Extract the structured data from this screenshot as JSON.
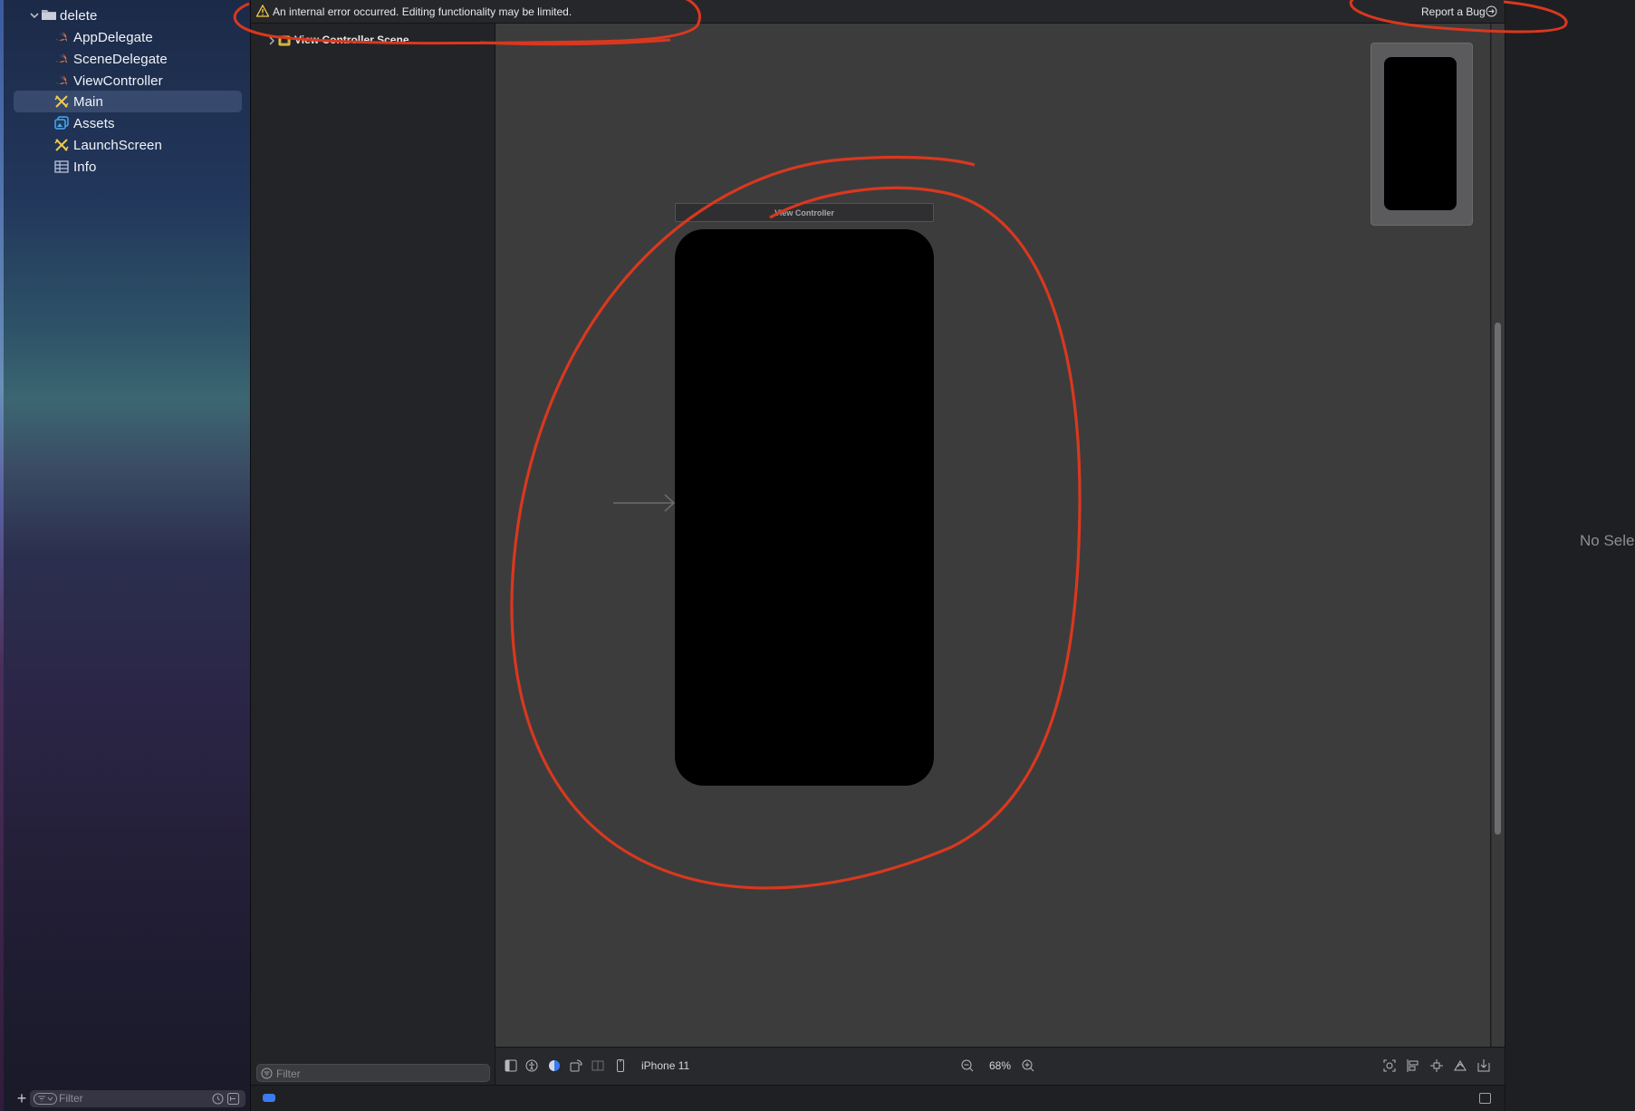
{
  "navigator": {
    "group": "delete",
    "items": [
      {
        "label": "AppDelegate",
        "icon": "swift-file-icon"
      },
      {
        "label": "SceneDelegate",
        "icon": "swift-file-icon"
      },
      {
        "label": "ViewController",
        "icon": "swift-file-icon"
      },
      {
        "label": "Main",
        "icon": "storyboard-icon",
        "selected": true
      },
      {
        "label": "Assets",
        "icon": "asset-catalog-icon"
      },
      {
        "label": "LaunchScreen",
        "icon": "storyboard-icon"
      },
      {
        "label": "Info",
        "icon": "plist-icon"
      }
    ],
    "filter_placeholder": "Filter"
  },
  "warning_bar": {
    "message": "An internal error occurred. Editing functionality may be limited.",
    "report_label": "Report a Bug"
  },
  "outline": {
    "scene_label": "View Controller Scene",
    "filter_placeholder": "Filter"
  },
  "canvas": {
    "scene_title": "View Controller"
  },
  "canvas_bar": {
    "device": "iPhone 11",
    "zoom": "68%"
  },
  "inspector": {
    "empty_text": "No Selection"
  },
  "colors": {
    "annotation": "#d9381e",
    "swift": "#f0773a",
    "storyboard": "#f2c94c",
    "assets": "#4aa7f0",
    "accent": "#3a7bf0"
  }
}
